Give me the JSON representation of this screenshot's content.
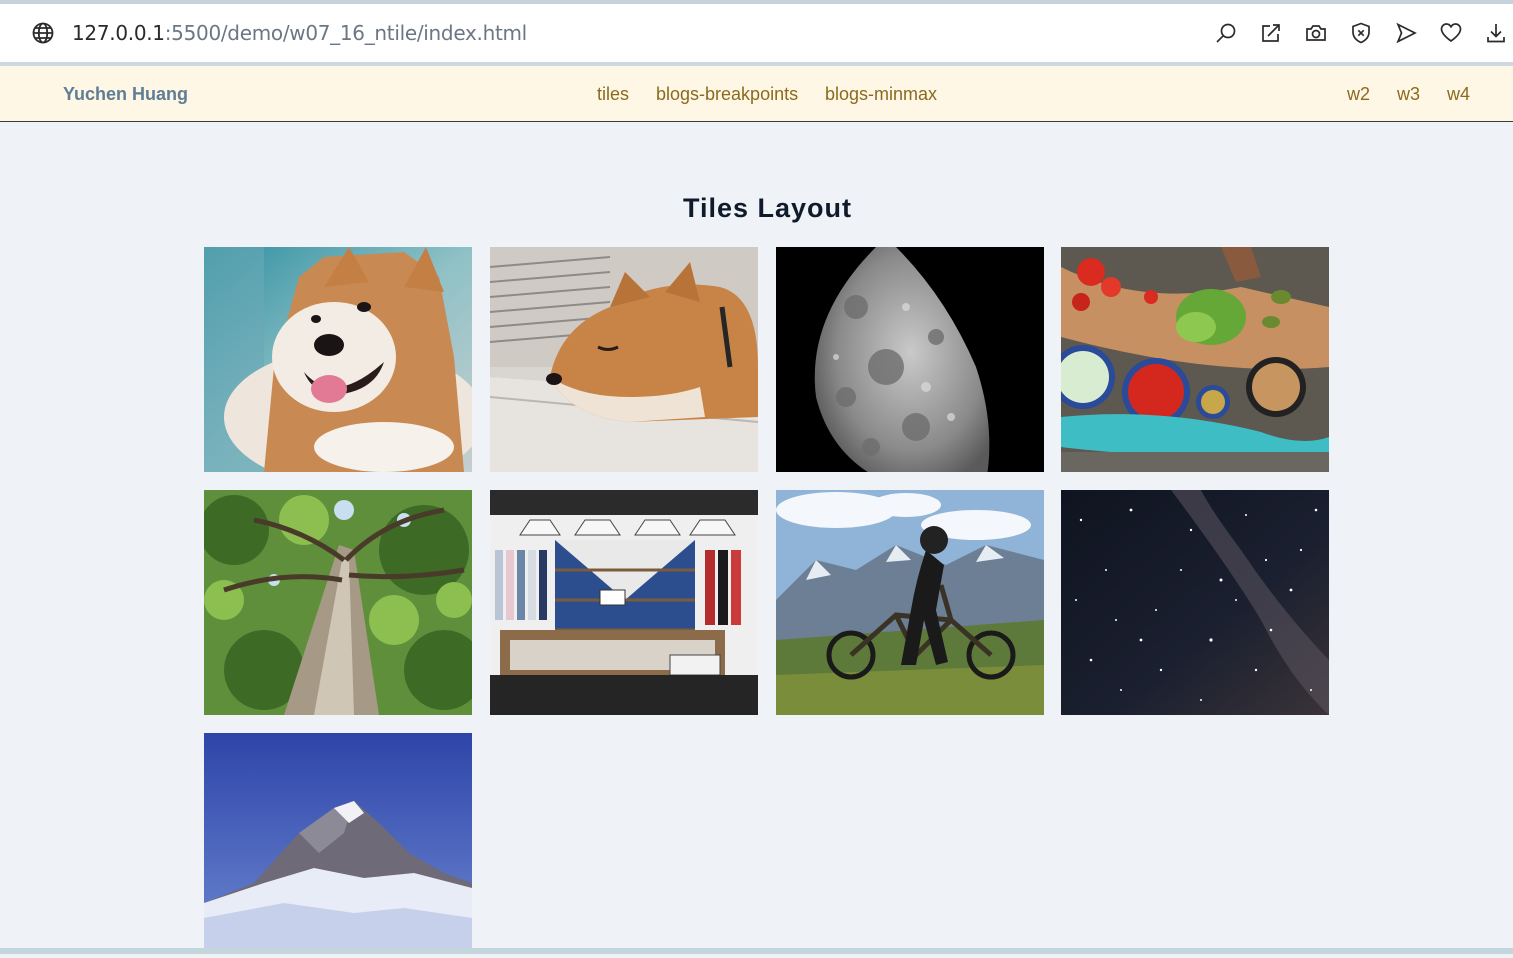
{
  "browser": {
    "url_host": "127.0.0.1",
    "url_rest": ":5500/demo/w07_16_ntile/index.html",
    "toolbar_icons": [
      "search-icon",
      "share-icon",
      "camera-icon",
      "shield-icon",
      "send-icon",
      "heart-icon",
      "download-icon"
    ]
  },
  "nav": {
    "brand": "Yuchen Huang",
    "center_links": [
      "tiles",
      "blogs-breakpoints",
      "blogs-minmax"
    ],
    "right_links": [
      "w2",
      "w3",
      "w4"
    ]
  },
  "main": {
    "title": "Tiles Layout",
    "tiles": [
      "shiba-inu-smiling-image",
      "shiba-inu-sleeping-image",
      "half-moon-image",
      "cooking-vegetables-image",
      "tree-trunk-image",
      "clothing-store-image",
      "mountain-biker-image",
      "starry-night-sky-image",
      "snowy-mountain-image"
    ]
  },
  "colors": {
    "page_bg": "#eff3f8",
    "nav_bg": "#fff7e6",
    "brand": "#5f7d95",
    "nav_link": "#8a6b1e",
    "title": "#0f1a2a"
  }
}
